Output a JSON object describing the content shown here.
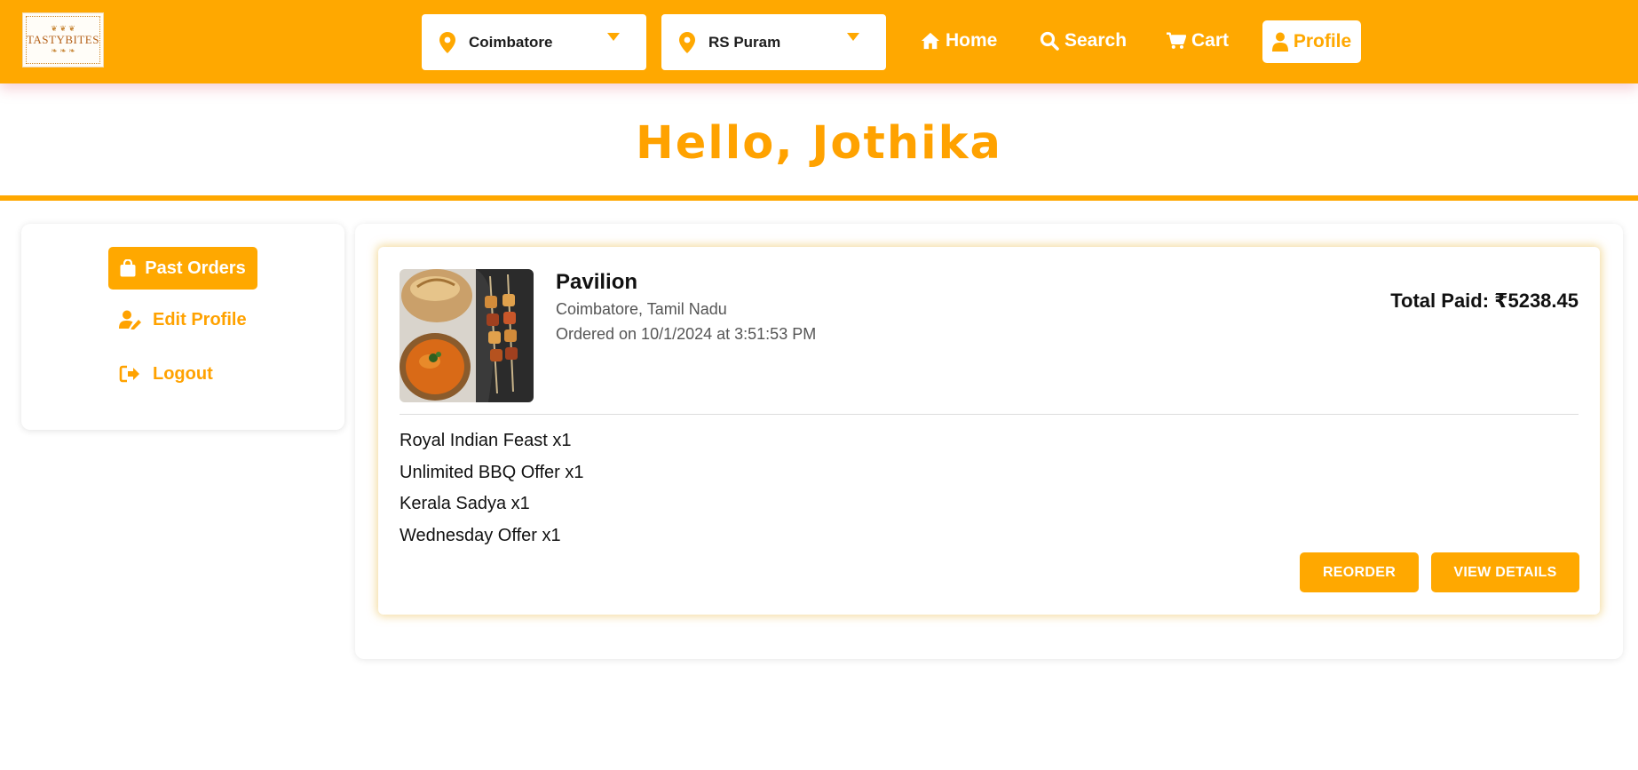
{
  "brand": {
    "logo_text": "TASTYBITES"
  },
  "header": {
    "city": "Coimbatore",
    "area": "RS Puram",
    "nav": {
      "home": "Home",
      "search": "Search",
      "cart": "Cart",
      "profile": "Profile"
    }
  },
  "greeting": "Hello, Jothika",
  "sidebar": {
    "past_orders": "Past Orders",
    "edit_profile": "Edit Profile",
    "logout": "Logout"
  },
  "order": {
    "restaurant": "Pavilion",
    "location": "Coimbatore, Tamil Nadu",
    "ordered_on": "Ordered on 10/1/2024 at 3:51:53 PM",
    "total_paid": "Total Paid: ₹5238.45",
    "items": [
      "Royal Indian Feast x1",
      "Unlimited BBQ Offer x1",
      "Kerala Sadya x1",
      "Wednesday Offer x1"
    ],
    "reorder_label": "REORDER",
    "view_details_label": "VIEW DETAILS"
  },
  "colors": {
    "accent": "#FFA800",
    "greeting": "#FFA200",
    "white": "#FFFFFF"
  },
  "icons": [
    "location-pin-icon",
    "chevron-down-icon",
    "home-icon",
    "search-icon",
    "cart-icon",
    "user-icon",
    "shopping-bag-icon",
    "user-edit-icon",
    "sign-out-icon"
  ]
}
